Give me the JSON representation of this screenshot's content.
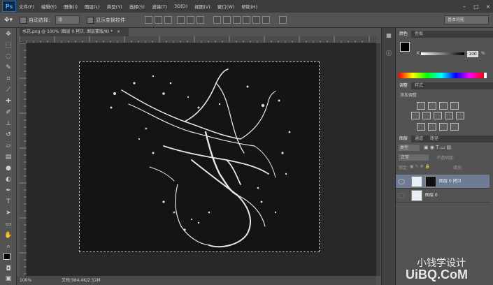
{
  "app": {
    "logo": "Ps"
  },
  "menu": [
    "文件(F)",
    "编辑(E)",
    "图像(I)",
    "图层(L)",
    "类型(Y)",
    "选择(S)",
    "滤镜(T)",
    "3D(D)",
    "视图(V)",
    "窗口(W)",
    "帮助(H)"
  ],
  "options": {
    "auto_select_label": "自动选择：",
    "auto_select_value": "组",
    "transform_label": "显示变换控件",
    "workspace": "基本功能"
  },
  "document": {
    "tab_title": "水花.png @ 100% (图层 0 拷贝, 图层蒙版/8) *",
    "tab_close": "×"
  },
  "status": {
    "zoom": "100%",
    "info": "文档:984.4K/2.52M"
  },
  "panels": {
    "color_tabs": [
      "颜色",
      "色板"
    ],
    "color_channel": "K",
    "color_value": "100",
    "color_unit": "%",
    "adjust_tabs": [
      "调整",
      "样式"
    ],
    "adjust_title": "添加调整",
    "layers_tabs": [
      "图层",
      "通道",
      "路径"
    ],
    "layer_filter": "类型",
    "blend_mode": "正常",
    "opacity_label": "不透明度:",
    "lock_label": "锁定:",
    "fill_label": "填充:",
    "layers": [
      {
        "name": "图层 0 拷贝",
        "selected": true
      },
      {
        "name": "图层 0",
        "selected": false
      }
    ]
  },
  "watermark": {
    "line1": "小钱学设计",
    "line2": "UiBQ.CoM"
  },
  "colors": {
    "accent_selected": "#6d7b93",
    "canvas_bg": "#141414",
    "menu_bg": "#3c3c3c"
  }
}
